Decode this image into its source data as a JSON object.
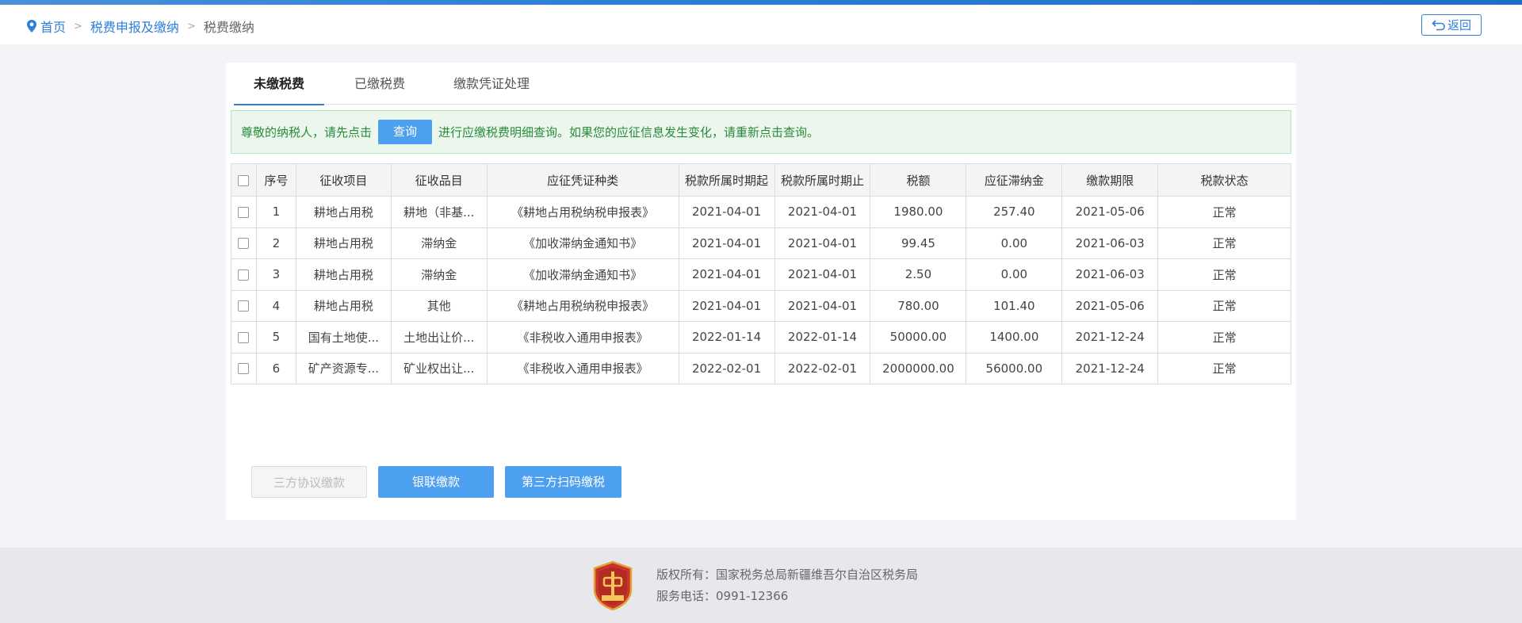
{
  "breadcrumb": {
    "home": "首页",
    "parent": "税费申报及缴纳",
    "current": "税费缴纳",
    "separator": ">"
  },
  "back_label": "返回",
  "tabs": [
    {
      "label": "未缴税费",
      "active": true
    },
    {
      "label": "已缴税费",
      "active": false
    },
    {
      "label": "缴款凭证处理",
      "active": false
    }
  ],
  "notice": {
    "prefix": "尊敬的纳税人，请先点击",
    "button": "查询",
    "suffix": "进行应缴税费明细查询。如果您的应征信息发生变化，请重新点击查询。"
  },
  "table": {
    "headers": [
      "序号",
      "征收项目",
      "征收品目",
      "应征凭证种类",
      "税款所属时期起",
      "税款所属时期止",
      "税额",
      "应征滞纳金",
      "缴款期限",
      "税款状态"
    ],
    "rows": [
      [
        "1",
        "耕地占用税",
        "耕地（非基...",
        "《耕地占用税纳税申报表》",
        "2021-04-01",
        "2021-04-01",
        "1980.00",
        "257.40",
        "2021-05-06",
        "正常"
      ],
      [
        "2",
        "耕地占用税",
        "滞纳金",
        "《加收滞纳金通知书》",
        "2021-04-01",
        "2021-04-01",
        "99.45",
        "0.00",
        "2021-06-03",
        "正常"
      ],
      [
        "3",
        "耕地占用税",
        "滞纳金",
        "《加收滞纳金通知书》",
        "2021-04-01",
        "2021-04-01",
        "2.50",
        "0.00",
        "2021-06-03",
        "正常"
      ],
      [
        "4",
        "耕地占用税",
        "其他",
        "《耕地占用税纳税申报表》",
        "2021-04-01",
        "2021-04-01",
        "780.00",
        "101.40",
        "2021-05-06",
        "正常"
      ],
      [
        "5",
        "国有土地使...",
        "土地出让价...",
        "《非税收入通用申报表》",
        "2022-01-14",
        "2022-01-14",
        "50000.00",
        "1400.00",
        "2021-12-24",
        "正常"
      ],
      [
        "6",
        "矿产资源专...",
        "矿业权出让...",
        "《非税收入通用申报表》",
        "2022-02-01",
        "2022-02-01",
        "2000000.00",
        "56000.00",
        "2021-12-24",
        "正常"
      ]
    ]
  },
  "buttons": {
    "tripartite": "三方协议缴款",
    "unionpay": "银联缴款",
    "scan": "第三方扫码缴税"
  },
  "footer": {
    "copyright": "版权所有：国家税务总局新疆维吾尔自治区税务局",
    "phone": "服务电话：0991-12366"
  },
  "colors": {
    "accent": "#2d7fd8",
    "button": "#4d9ff0",
    "notice_bg": "#ebf7ed",
    "notice_text": "#2a8a3c"
  }
}
